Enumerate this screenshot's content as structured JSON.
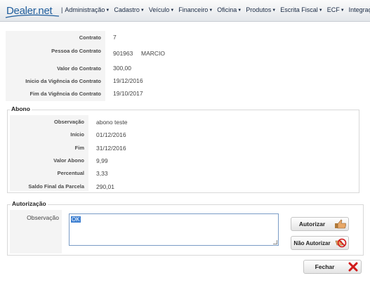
{
  "app": {
    "logo": "Dealer.net"
  },
  "nav": {
    "separator": "|",
    "items": [
      {
        "label": "Administração"
      },
      {
        "label": "Cadastro"
      },
      {
        "label": "Veículo"
      },
      {
        "label": "Financeiro"
      },
      {
        "label": "Oficina"
      },
      {
        "label": "Produtos"
      },
      {
        "label": "Escrita Fiscal"
      },
      {
        "label": "ECF"
      },
      {
        "label": "Integração"
      }
    ]
  },
  "contract": {
    "contrato_label": "Contrato",
    "contrato_value": "7",
    "pessoa_label": "Pessoa do Contrato",
    "pessoa_code": "901963",
    "pessoa_name": "MARCIO",
    "valor_label": "Valor do Contrato",
    "valor_value": "300,00",
    "inicio_label": "Inicio da Vigência do Contrato",
    "inicio_value": "19/12/2016",
    "fim_label": "Fim da Vigência do Contrato",
    "fim_value": "19/10/2017"
  },
  "abono": {
    "legend": "Abono",
    "observacao_label": "Observação",
    "observacao_value": "abono teste",
    "inicio_label": "Início",
    "inicio_value": "01/12/2016",
    "fim_label": "Fim",
    "fim_value": "31/12/2016",
    "valor_label": "Valor Abono",
    "valor_value": "9,99",
    "percentual_label": "Percentual",
    "percentual_value": "3,33",
    "saldo_label": "Saldo Final da Parcela",
    "saldo_value": "290,01"
  },
  "autorizacao": {
    "legend": "Autorização",
    "observacao_label": "Observação",
    "observacao_value": "OK",
    "autorizar_label": "Autorizar",
    "nao_autorizar_label": "Não Autorizar"
  },
  "footer": {
    "fechar_label": "Fechar"
  },
  "colors": {
    "accent": "#1f5d9c",
    "selection": "#3d7fd1",
    "close_red": "#d11a1a"
  }
}
